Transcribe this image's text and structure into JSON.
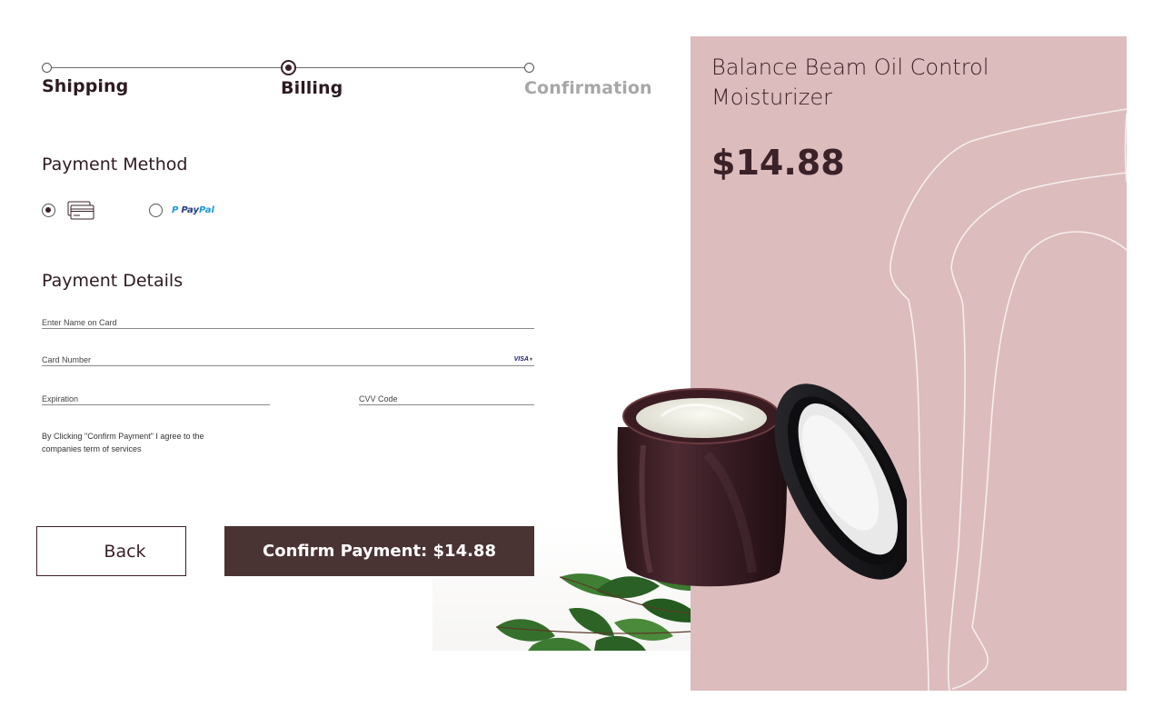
{
  "progress": {
    "steps": [
      {
        "label": "Shipping",
        "state": "completed"
      },
      {
        "label": "Billing",
        "state": "active"
      },
      {
        "label": "Confirmation",
        "state": "inactive"
      }
    ]
  },
  "payment_method": {
    "title": "Payment Method",
    "options": [
      {
        "name": "card",
        "icon": "credit-card-icon",
        "selected": true
      },
      {
        "name": "paypal",
        "label_p": "P",
        "label_pay": "Pay",
        "label_pal": "Pal",
        "selected": false
      }
    ]
  },
  "payment_details": {
    "title": "Payment Details",
    "name_placeholder": "Enter Name on Card",
    "card_placeholder": "Card Number",
    "card_brand": "VISA",
    "expiration_placeholder": "Expiration",
    "cvv_placeholder": "CVV Code",
    "terms": "By Clicking \"Confirm Payment\" I agree to the companies term of services"
  },
  "actions": {
    "back_label": "Back",
    "confirm_label": "Confirm Payment: $14.88"
  },
  "product": {
    "name": "Balance Beam Oil Control Moisturizer",
    "price": "$14.88",
    "panel_color": "#dcbcbd"
  },
  "colors": {
    "primary": "#4a3333",
    "text": "#2e1a22",
    "inactive": "#a7a7a7"
  }
}
